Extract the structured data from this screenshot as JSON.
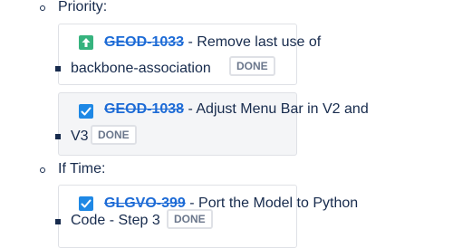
{
  "sections": [
    {
      "label": "Priority:",
      "items": [
        {
          "icon": "up-arrow-icon",
          "key": "GEOD-1033",
          "summary_line1": " - Remove last use of",
          "summary_line2": "backbone-association",
          "status": "DONE"
        },
        {
          "icon": "checkbox-icon",
          "key": "GEOD-1038",
          "summary_line1": " - Adjust Menu Bar in V2 and",
          "summary_line2": "V3",
          "status": "DONE"
        }
      ]
    },
    {
      "label": "If Time:",
      "items": [
        {
          "icon": "checkbox-icon",
          "key": "GLGVO-399",
          "summary_line1": " - Port the Model to Python",
          "summary_line2": "Code - Step 3",
          "status": "DONE"
        }
      ]
    }
  ],
  "colors": {
    "link": "#1d6bd6",
    "check": "#1e88e5",
    "up": "#36b37e",
    "status_border": "#dfe1e6",
    "status_text": "#6b778c"
  }
}
